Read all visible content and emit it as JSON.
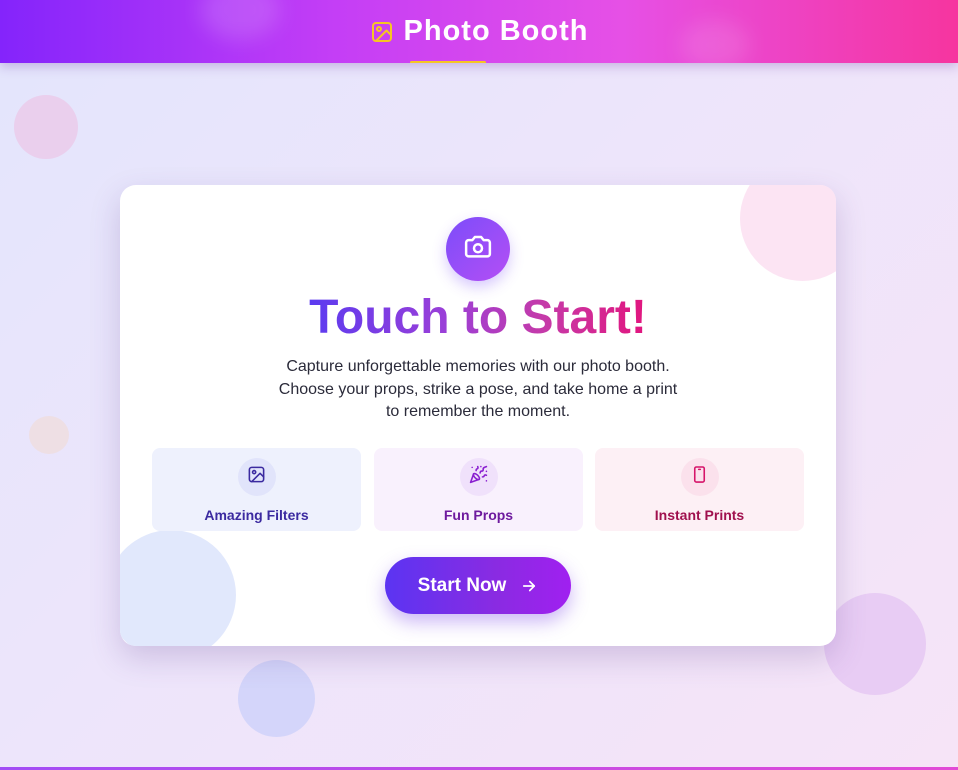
{
  "header": {
    "title": "Photo Booth",
    "icon": "image-icon",
    "accent_color": "#f5c623"
  },
  "main": {
    "hero_icon": "camera-icon",
    "title": "Touch to Start!",
    "description_lines": [
      "Capture unforgettable memories with our photo booth.",
      "Choose your props, strike a pose, and take home a print",
      "to remember the moment."
    ],
    "features": [
      {
        "label": "Amazing Filters",
        "icon": "image-icon",
        "color": "#3b2aa0",
        "bg": "#eef1fd"
      },
      {
        "label": "Fun Props",
        "icon": "party-popper-icon",
        "color": "#6e1a9e",
        "bg": "#f9f1fd"
      },
      {
        "label": "Instant Prints",
        "icon": "smartphone-icon",
        "color": "#a0104e",
        "bg": "#fdf0f5"
      }
    ],
    "start_button": {
      "label": "Start Now",
      "icon": "arrow-right-icon"
    }
  },
  "colors": {
    "header_gradient_start": "#8424fb",
    "header_gradient_end": "#f6359f",
    "button_gradient_start": "#5b34f2",
    "button_gradient_end": "#a020f0"
  }
}
